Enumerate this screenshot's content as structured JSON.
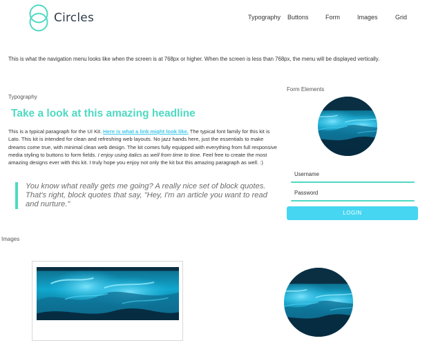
{
  "brand": {
    "name": "Circles",
    "accent": "#4fd9c2",
    "button_color": "#46d6f1",
    "link_color": "#3fc6ea"
  },
  "nav": {
    "items": [
      "Typography",
      "Buttons",
      "Form",
      "Images",
      "Grid"
    ]
  },
  "intro_text": "This is what the navigation menu looks like when the screen is at 768px or higher. When the screen is less than 768px, the menu will be displayed vertically.",
  "typography": {
    "label": "Typography",
    "headline": "Take a look at this amazing headline",
    "para_1": "This is a typical paragraph for the UI Kit. ",
    "link": "Here is what a link might look like.",
    "para_2": " The typical font family for this kit is Lato. This kit is intended for clean and refreshing web layouts. No jazz hands here, just the essentials to make dreams come true, with minimal clean web design. The kit comes fully equipped with everything from full responsive media styling to buttons to form fields. ",
    "italic": "I enjoy using italics as well from time to time.",
    "para_3": " Feel free to create the most amazing designs ever with this kit. I truly hope you enjoy not only the kit but this amazing paragraph as well. :)",
    "blockquote": "You know what really gets me going? A really nice set of block quotes. That's right, block quotes that say, \"Hey, I'm an article you want to read and nurture.\""
  },
  "form": {
    "label": "Form Elements",
    "username": "Username",
    "password": "Password",
    "login": "LOGIN"
  },
  "images": {
    "label": "Images"
  }
}
